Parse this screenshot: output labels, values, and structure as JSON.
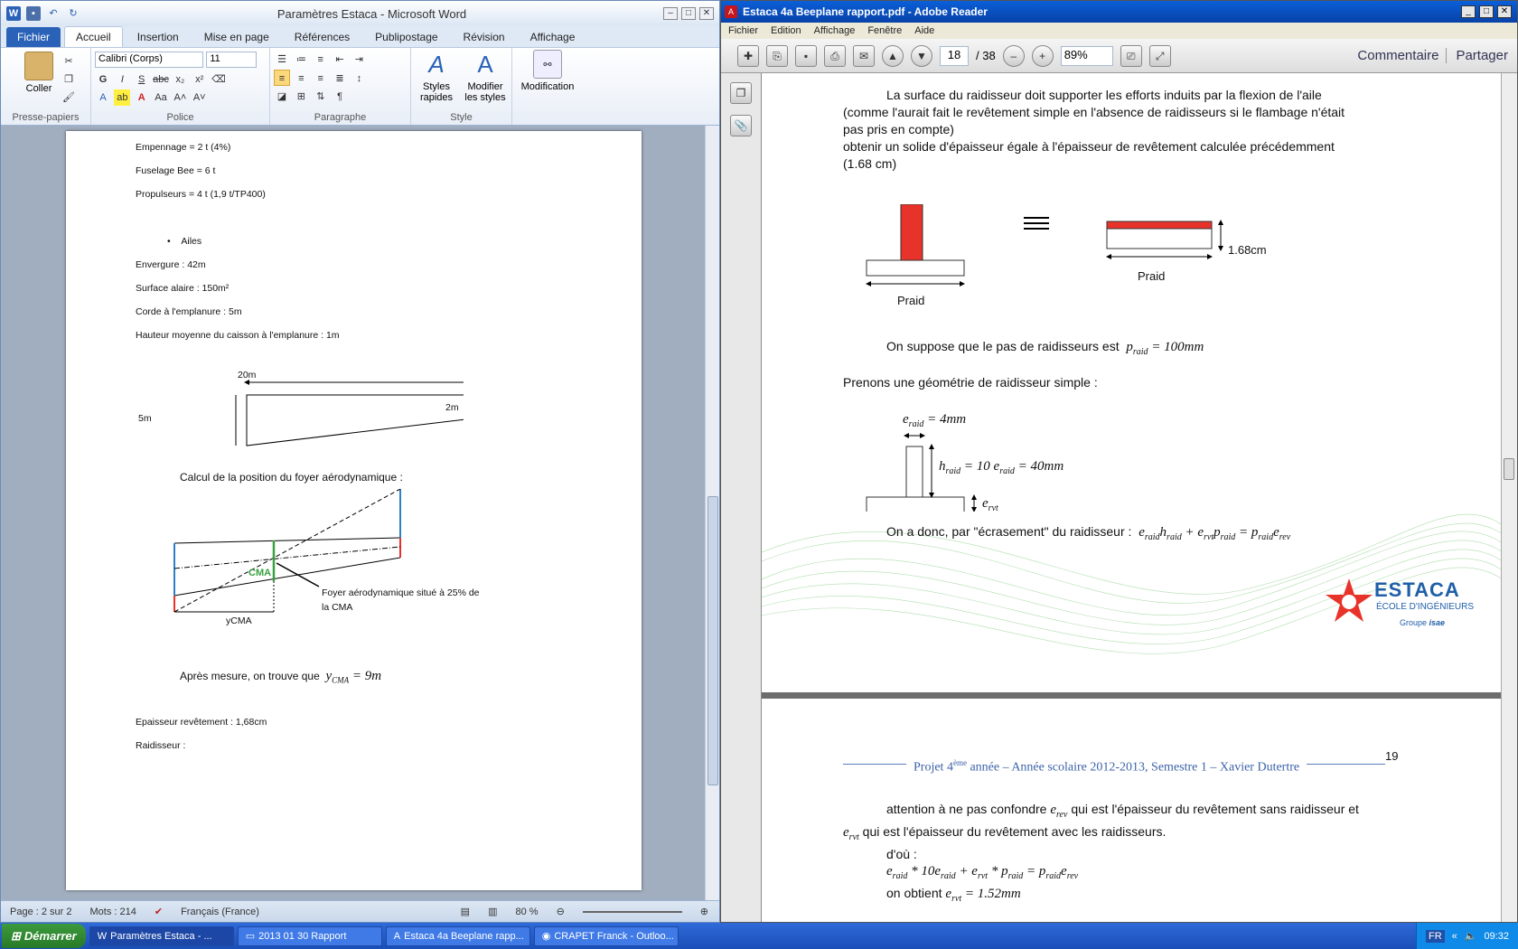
{
  "word": {
    "title": "Paramètres Estaca  -  Microsoft Word",
    "tabs": [
      "Fichier",
      "Accueil",
      "Insertion",
      "Mise en page",
      "Références",
      "Publipostage",
      "Révision",
      "Affichage"
    ],
    "font_name": "Calibri (Corps)",
    "font_size": "11",
    "groups": {
      "clipboard": "Presse-papiers",
      "font": "Police",
      "paragraph": "Paragraphe",
      "style": "Style"
    },
    "buttons": {
      "paste": "Coller",
      "quick_styles_1": "Styles",
      "quick_styles_2": "rapides",
      "modify_styles_1": "Modifier",
      "modify_styles_2": "les styles",
      "modification": "Modification"
    },
    "doc": {
      "l1": "Empennage = 2 t (4%)",
      "l2": "Fuselage Bee = 6 t",
      "l3": "Propulseurs = 4 t (1,9 t/TP400)",
      "bullet": "Ailes",
      "l4": "Envergure : 42m",
      "l5": "Surface alaire : 150m²",
      "l6": "Corde à l'emplanure : 5m",
      "l7": "Hauteur moyenne du caisson à l'emplanure : 1m",
      "fig1_top": "20m",
      "fig1_left": "5m",
      "fig1_right": "2m",
      "calc": "Calcul de la position du foyer aérodynamique :",
      "cma": "CMA",
      "foyer1": "Foyer aérodynamique situé à 25% de",
      "foyer2": "la CMA",
      "ycma": "yCMA",
      "mesure": "Après mesure, on trouve que",
      "mesure_math": "y",
      "mesure_sub": "CMA",
      "mesure_val": " = 9m",
      "ep": "Epaisseur revêtement : 1,68cm",
      "raid": "Raidisseur :"
    },
    "status": {
      "page": "Page : 2 sur 2",
      "words": "Mots : 214",
      "lang": "Français (France)",
      "zoom": "80 %"
    }
  },
  "reader": {
    "title": "Estaca 4a Beeplane rapport.pdf - Adobe Reader",
    "menu": [
      "Fichier",
      "Edition",
      "Affichage",
      "Fenêtre",
      "Aide"
    ],
    "page_current": "18",
    "page_total": "/ 38",
    "zoom": "89%",
    "comment": "Commentaire",
    "share": "Partager",
    "p1": {
      "t1": "La surface du raidisseur doit supporter les efforts induits par la flexion de l'aile",
      "t2": "(comme l'aurait fait le revêtement simple en l'absence de raidisseurs si le flambage n'était",
      "t3": "pas pris en compte)",
      "t4": "obtenir un solide d'épaisseur égale à l'épaisseur de revêtement calculée précédemment",
      "t5": "(1.68 cm)",
      "praid1": "Praid",
      "praid2": "Praid",
      "dim": "1.68cm",
      "pas": "On suppose que le pas de raidisseurs est",
      "pas_math": "p",
      "pas_sub": "raid",
      "pas_val": " = 100mm",
      "geo": "Prenons une géométrie de raidisseur simple :",
      "e_math": "e",
      "e_sub": "raid",
      "e_val": " = 4mm",
      "h_math": "h",
      "h_sub": "raid",
      "h_val": " = 10 e",
      "h_sub2": "raid",
      "h_val2": " = 40mm",
      "ervt": "e",
      "ervt_sub": "rvt",
      "ecr": "On a donc, par \"écrasement\" du raidisseur :",
      "logo1": "ESTACA",
      "logo2": "ÉCOLE D'INGÉNIEURS",
      "logo3": "Groupe",
      "logo4": "isae"
    },
    "p2": {
      "num": "19",
      "header_a": "Projet 4",
      "header_sup": "ème",
      "header_b": " année – Année scolaire 2012-2013, Semestre 1 – Xavier Dutertre",
      "t1a": "attention à ne pas confondre",
      "t1b": "qui est l'épaisseur du revêtement sans raidisseur et",
      "t2": "qui est l'épaisseur du revêtement avec les raidisseurs.",
      "t3": "d'où :",
      "t4": "on obtient",
      "t4_val": " = 1.52mm"
    }
  },
  "taskbar": {
    "start": "Démarrer",
    "items": [
      "Paramètres Estaca - ...",
      "2013 01 30 Rapport",
      "Estaca 4a Beeplane rapp...",
      "CRAPET Franck - Outloo..."
    ],
    "lang": "FR",
    "time": "09:32"
  },
  "colors": {
    "word_blue": "#2a62b8",
    "raid_red": "#e8332a",
    "cma_green": "#3aa040",
    "wing_blue": "#2f7fc8",
    "estaca_blue": "#1f5fa8"
  }
}
